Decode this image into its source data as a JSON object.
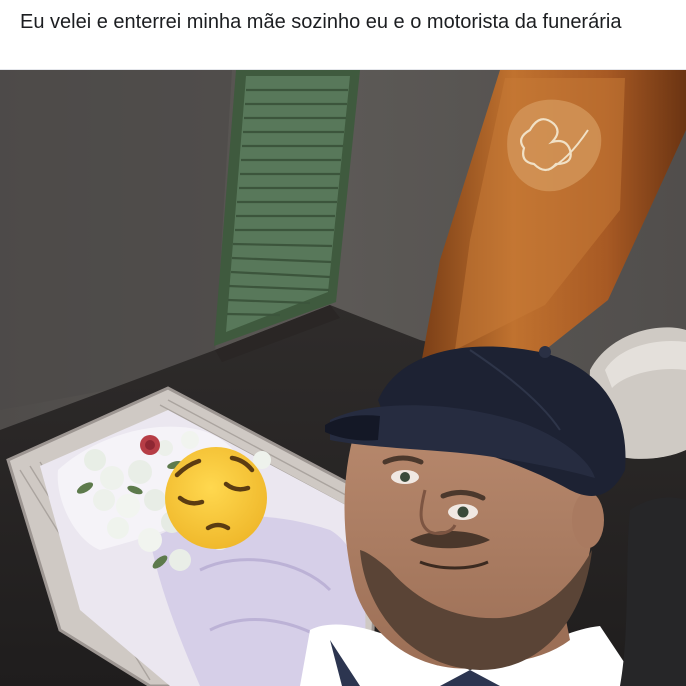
{
  "post": {
    "caption": "Eu velei e enterrei minha mãe sozinho eu e o motorista da funerária"
  },
  "photo": {
    "overlay_emoji": "pensive-face",
    "colors": {
      "wall": "#55524f",
      "door": "#4e6a4c",
      "coffin_lid": "#b2652a",
      "cap": "#1d2233",
      "lining": "#d9d3ea",
      "emoji": "#f3c53a"
    }
  }
}
